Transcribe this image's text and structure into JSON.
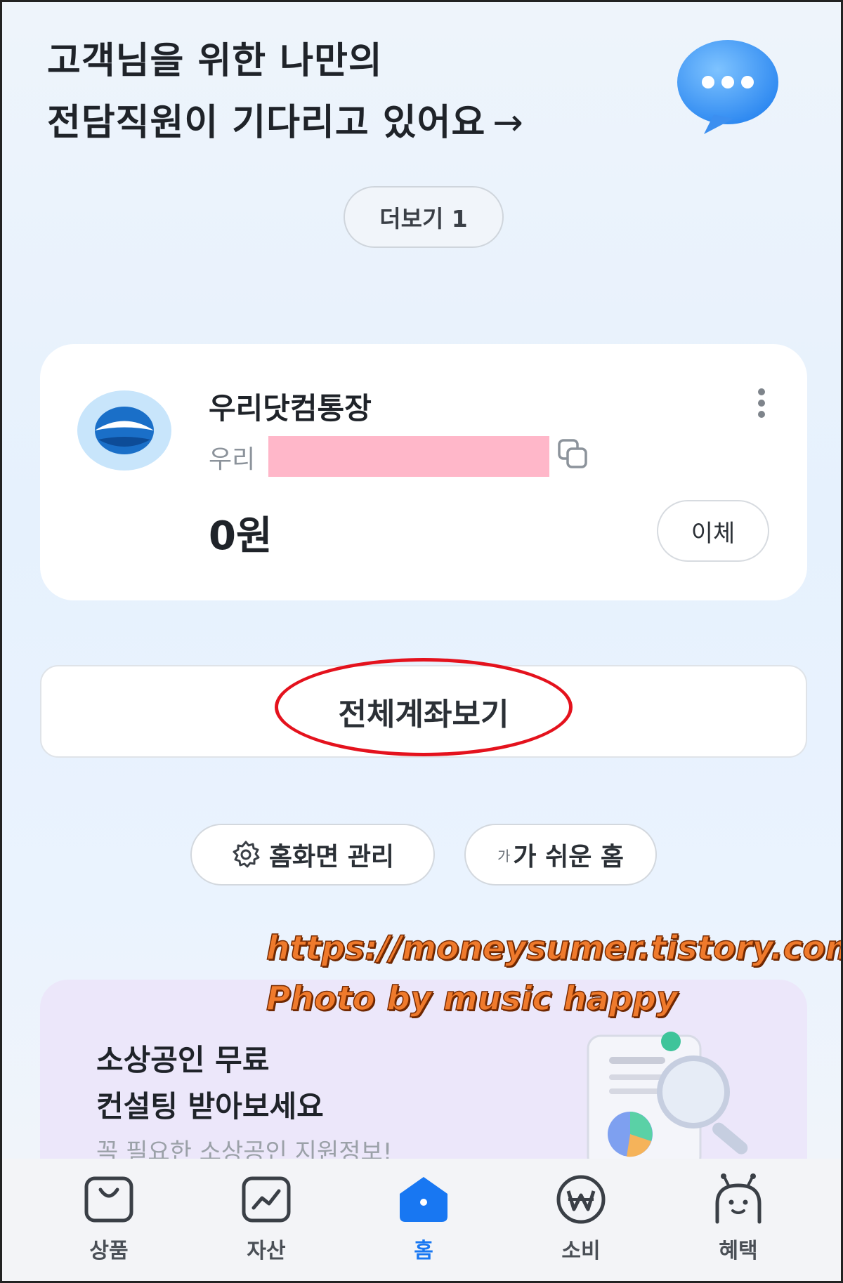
{
  "header": {
    "line1": "고객님을 위한 나만의",
    "line2": "전담직원이 기다리고 있어요",
    "arrow": "→",
    "more_label": "더보기 1"
  },
  "account": {
    "name": "우리닷컴통장",
    "bank": "우리",
    "balance": "0원",
    "transfer_label": "이체"
  },
  "all_accounts_label": "전체계좌보기",
  "shortcuts": {
    "home_manage": "홈화면 관리",
    "easy_home_small": "가",
    "easy_home": "가 쉬운 홈"
  },
  "promo": {
    "title_line1": "소상공인 무료",
    "title_line2": "컨설팅 받아보세요",
    "subtitle": "꼭 필요한 소상공인 지원정보!"
  },
  "watermark": {
    "line1": "https://moneysumer.tistory.com",
    "line2": "Photo by music happy"
  },
  "tabbar": {
    "items": [
      {
        "label": "상품",
        "icon": "shopping-bag-icon"
      },
      {
        "label": "자산",
        "icon": "asset-chart-icon"
      },
      {
        "label": "홈",
        "icon": "home-icon",
        "active": true
      },
      {
        "label": "소비",
        "icon": "won-coin-icon"
      },
      {
        "label": "혜택",
        "icon": "character-face-icon"
      }
    ]
  },
  "colors": {
    "accent": "#1877f2",
    "highlight_ellipse": "#e4121d",
    "masked_account": "#ffb7c9",
    "watermark": "#ef7a2c"
  }
}
